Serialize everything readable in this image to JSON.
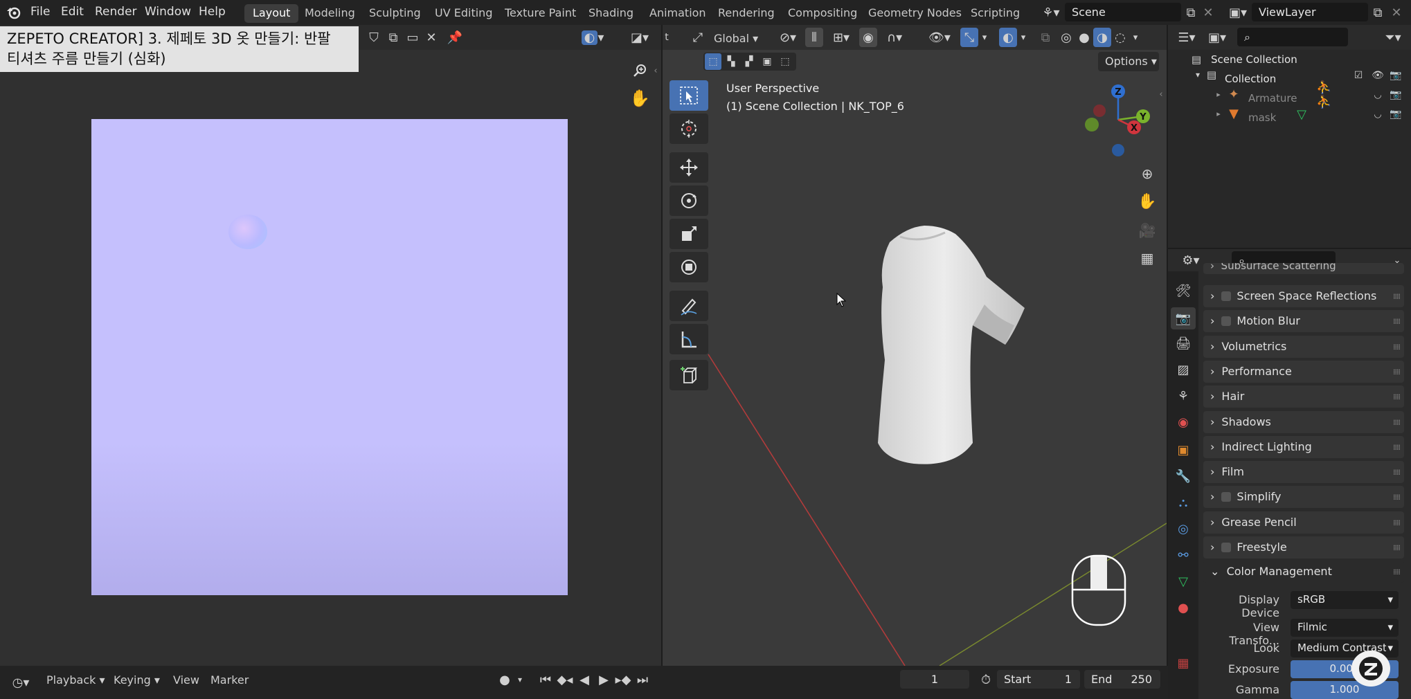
{
  "menu": [
    "File",
    "Edit",
    "Render",
    "Window",
    "Help"
  ],
  "workspaces": [
    "Layout",
    "Modeling",
    "Sculpting",
    "UV Editing",
    "Texture Paint",
    "Shading",
    "Animation",
    "Rendering",
    "Compositing",
    "Geometry Nodes",
    "Scripting"
  ],
  "scene": "Scene",
  "view_layer": "ViewLayer",
  "video_title_line1": "ZEPETO CREATOR] 3. 제페토 3D 옷 만들기: 반팔",
  "video_title_line2": "티셔츠 주름 만들기 (심화)",
  "viewport": {
    "orientation": "Global",
    "options": "Options",
    "view_name": "User Perspective",
    "view_info": "(1) Scene Collection | NK_TOP_6",
    "axis_x": "X",
    "axis_y": "Y",
    "axis_z": "Z"
  },
  "outliner": {
    "scene_collection": "Scene Collection",
    "collection": "Collection",
    "items": [
      "Armature",
      "mask"
    ]
  },
  "properties": {
    "partial_top": "Subsurface Scattering",
    "panels": [
      {
        "label": "Screen Space Reflections",
        "checkbox": true
      },
      {
        "label": "Motion Blur",
        "checkbox": true
      },
      {
        "label": "Volumetrics",
        "checkbox": false
      },
      {
        "label": "Performance",
        "checkbox": false
      },
      {
        "label": "Hair",
        "checkbox": false
      },
      {
        "label": "Shadows",
        "checkbox": false
      },
      {
        "label": "Indirect Lighting",
        "checkbox": false
      },
      {
        "label": "Film",
        "checkbox": false
      },
      {
        "label": "Simplify",
        "checkbox": true
      },
      {
        "label": "Grease Pencil",
        "checkbox": false
      },
      {
        "label": "Freestyle",
        "checkbox": true
      }
    ],
    "color_management": {
      "title": "Color Management",
      "display_device_label": "Display Device",
      "display_device": "sRGB",
      "view_transform_label": "View Transfo...",
      "view_transform": "Filmic",
      "look_label": "Look",
      "look": "Medium Contrast",
      "exposure_label": "Exposure",
      "exposure": "0.000",
      "gamma_label": "Gamma",
      "gamma": "1.000"
    }
  },
  "timeline": {
    "playback": "Playback",
    "keying": "Keying",
    "view": "View",
    "marker": "Marker",
    "current_frame": "1",
    "start_label": "Start",
    "start": "1",
    "end_label": "End",
    "end": "250"
  },
  "colors": {
    "accent": "#4772b3",
    "normal_map": "#c5c0fd",
    "shirt": "#e4e4e4"
  }
}
